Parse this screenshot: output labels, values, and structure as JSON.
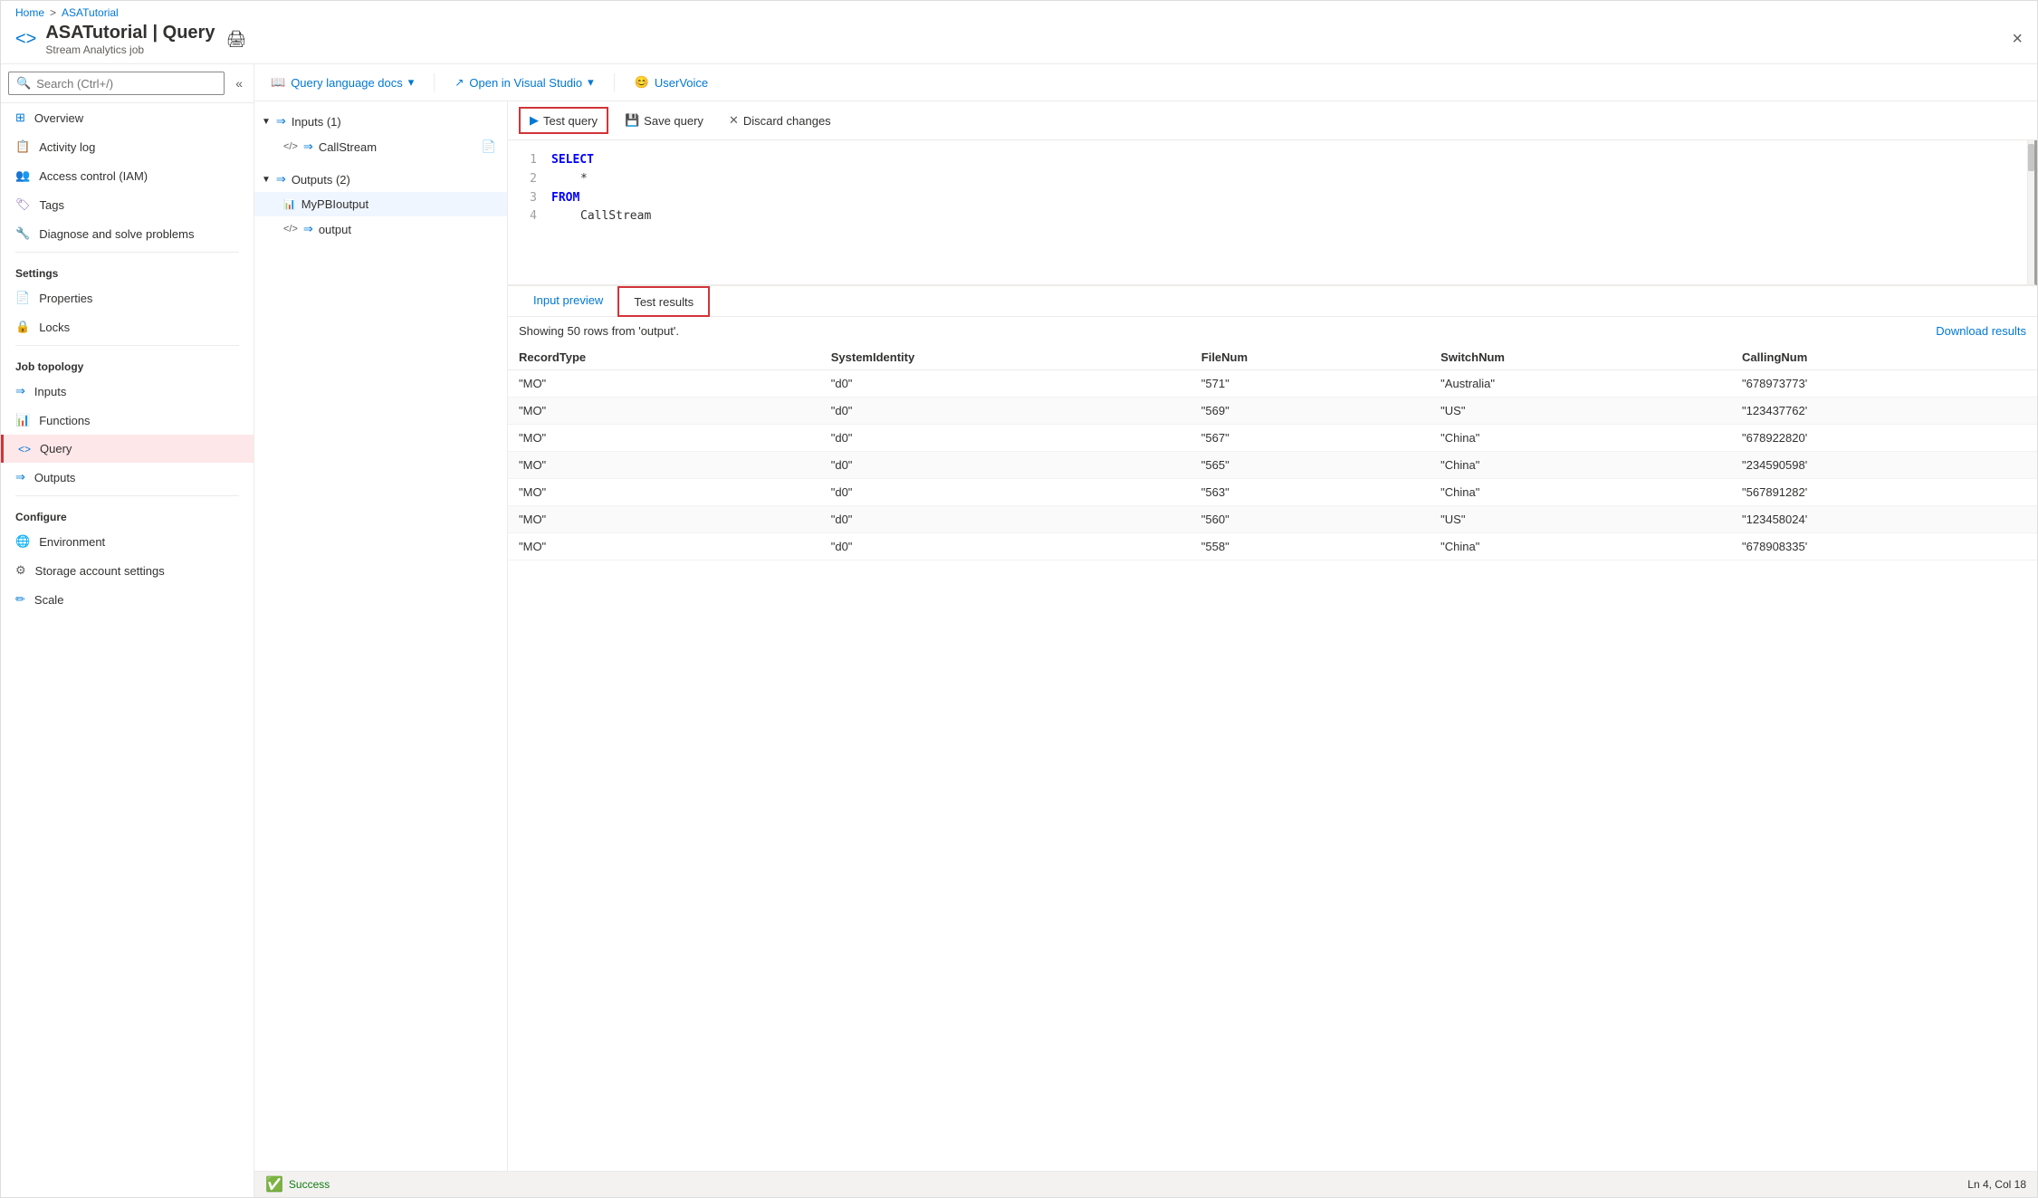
{
  "breadcrumb": {
    "home": "Home",
    "separator": ">",
    "current": "ASATutorial"
  },
  "header": {
    "title": "ASATutorial | Query",
    "subtitle": "Stream Analytics job",
    "print_label": "🖨",
    "close_label": "×"
  },
  "search": {
    "placeholder": "Search (Ctrl+/)"
  },
  "sidebar": {
    "collapse_icon": "«",
    "nav_items": [
      {
        "id": "overview",
        "label": "Overview",
        "icon": "⊞"
      },
      {
        "id": "activity-log",
        "label": "Activity log",
        "icon": "📋"
      },
      {
        "id": "access-control",
        "label": "Access control (IAM)",
        "icon": "👥"
      },
      {
        "id": "tags",
        "label": "Tags",
        "icon": "🏷"
      },
      {
        "id": "diagnose",
        "label": "Diagnose and solve problems",
        "icon": "🔧"
      }
    ],
    "settings_label": "Settings",
    "settings_items": [
      {
        "id": "properties",
        "label": "Properties",
        "icon": "📄"
      },
      {
        "id": "locks",
        "label": "Locks",
        "icon": "🔒"
      }
    ],
    "job_topology_label": "Job topology",
    "job_topology_items": [
      {
        "id": "inputs",
        "label": "Inputs",
        "icon": "⇒"
      },
      {
        "id": "functions",
        "label": "Functions",
        "icon": "📊"
      },
      {
        "id": "query",
        "label": "Query",
        "icon": "<>"
      },
      {
        "id": "outputs",
        "label": "Outputs",
        "icon": "⇒"
      }
    ],
    "configure_label": "Configure",
    "configure_items": [
      {
        "id": "environment",
        "label": "Environment",
        "icon": "🌐"
      },
      {
        "id": "storage-account",
        "label": "Storage account settings",
        "icon": "⚙"
      },
      {
        "id": "scale",
        "label": "Scale",
        "icon": "✏"
      }
    ]
  },
  "toolbar": {
    "query_language_docs": "Query language docs",
    "query_language_docs_dropdown": true,
    "open_in_vs": "Open in Visual Studio",
    "open_in_vs_dropdown": true,
    "uservoice": "UserVoice"
  },
  "io_tree": {
    "inputs_label": "Inputs (1)",
    "inputs_items": [
      {
        "id": "callstream",
        "label": "CallStream",
        "has_icon": true
      }
    ],
    "outputs_label": "Outputs (2)",
    "outputs_items": [
      {
        "id": "mypboutput",
        "label": "MyPBIoutput"
      },
      {
        "id": "output",
        "label": "output"
      }
    ]
  },
  "query_actions": {
    "test_query": "Test query",
    "save_query": "Save query",
    "discard_changes": "Discard changes"
  },
  "code_editor": {
    "lines": [
      {
        "num": "1",
        "content": "SELECT",
        "type": "keyword"
      },
      {
        "num": "2",
        "content": "        *",
        "type": "value"
      },
      {
        "num": "3",
        "content": "FROM",
        "type": "keyword"
      },
      {
        "num": "4",
        "content": "        CallStream",
        "type": "identifier"
      }
    ]
  },
  "results": {
    "input_preview_label": "Input preview",
    "test_results_label": "Test results",
    "showing_text": "Showing 50 rows from 'output'.",
    "download_label": "Download results",
    "columns": [
      "RecordType",
      "SystemIdentity",
      "FileNum",
      "SwitchNum",
      "CallingNum"
    ],
    "rows": [
      [
        "\"MO\"",
        "\"d0\"",
        "\"571\"",
        "\"Australia\"",
        "\"678973773'"
      ],
      [
        "\"MO\"",
        "\"d0\"",
        "\"569\"",
        "\"US\"",
        "\"123437762'"
      ],
      [
        "\"MO\"",
        "\"d0\"",
        "\"567\"",
        "\"China\"",
        "\"678922820'"
      ],
      [
        "\"MO\"",
        "\"d0\"",
        "\"565\"",
        "\"China\"",
        "\"234590598'"
      ],
      [
        "\"MO\"",
        "\"d0\"",
        "\"563\"",
        "\"China\"",
        "\"567891282'"
      ],
      [
        "\"MO\"",
        "\"d0\"",
        "\"560\"",
        "\"US\"",
        "\"123458024'"
      ],
      [
        "\"MO\"",
        "\"d0\"",
        "\"558\"",
        "\"China\"",
        "\"678908335'"
      ]
    ]
  },
  "status_bar": {
    "success_label": "Success",
    "cursor_position": "Ln 4, Col 18"
  }
}
